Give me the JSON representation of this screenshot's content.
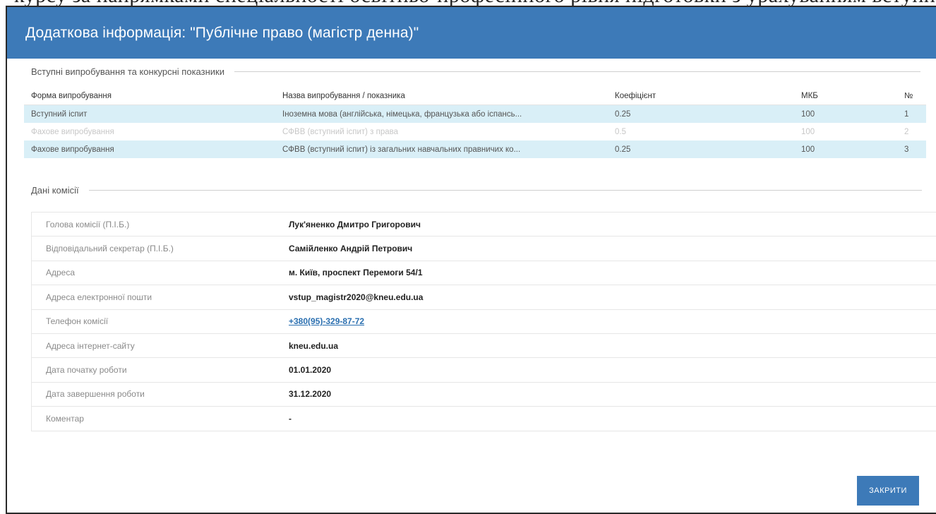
{
  "background": {
    "text": "курсу за напрямками спеціальності освітньо-професійного рівня підготовки з урахуванням вступних"
  },
  "modal": {
    "title": "Додаткова інформація: \"Публічне право (магістр денна)\"",
    "close_label": "ЗАКРИТИ",
    "header_color": "#3d7ab8"
  },
  "tests_section": {
    "legend": "Вступні випробування та конкурсні показники",
    "headers": [
      "Форма випробування",
      "Назва випробування / показника",
      "Коефіцієнт",
      "МКБ",
      "№"
    ],
    "rows": [
      [
        "Вступний іспит",
        "Іноземна мова (англійська, німецька, французька або іспансь...",
        "0.25",
        "100",
        "1"
      ],
      [
        "Фахове випробування",
        "СФВВ (вступний іспит) з права",
        "0.5",
        "100",
        "2"
      ],
      [
        "Фахове випробування",
        "СФВВ (вступний іспит) із загальних навчальних правничих ко...",
        "0.25",
        "100",
        "3"
      ]
    ]
  },
  "commission_section": {
    "legend": "Дані комісії",
    "rows": [
      {
        "label": "Голова комісії (П.І.Б.)",
        "value": "Лук'яненко Дмитро Григорович"
      },
      {
        "label": "Відповідальний секретар (П.І.Б.)",
        "value": "Самійленко Андрій Петрович"
      },
      {
        "label": "Адреса",
        "value": "м. Київ, проспект Перемоги 54/1"
      },
      {
        "label": "Адреса електронної пошти",
        "value": "vstup_magistr2020@kneu.edu.ua"
      },
      {
        "label": "Телефон комісії",
        "value": "+380(95)-329-87-72"
      },
      {
        "label": "Адреса інтернет-сайту",
        "value": "kneu.edu.ua"
      },
      {
        "label": "Дата початку роботи",
        "value": "01.01.2020"
      },
      {
        "label": "Дата завершення роботи",
        "value": "31.12.2020"
      },
      {
        "label": "Коментар",
        "value": "-"
      }
    ]
  }
}
